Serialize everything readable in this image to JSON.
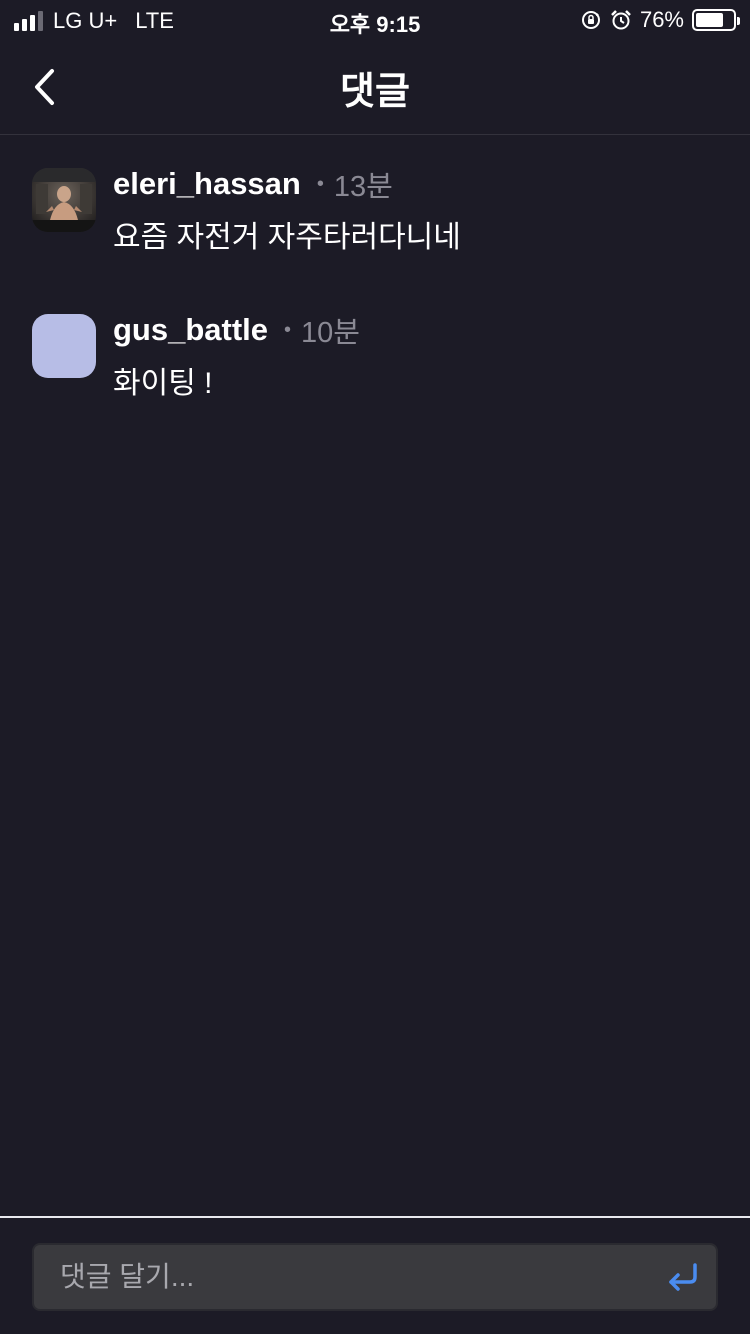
{
  "status_bar": {
    "carrier": "LG U+",
    "network": "LTE",
    "time": "오후 9:15",
    "battery": "76%",
    "battery_level": 0.76
  },
  "nav": {
    "title": "댓글",
    "back_icon": "chevron-left-icon"
  },
  "comments": [
    {
      "username": "eleri_hassan",
      "time": "13분",
      "text": "요즘 자전거 자주타러다니네",
      "avatar": "photo"
    },
    {
      "username": "gus_battle",
      "time": "10분",
      "text": "화이팅 !",
      "avatar": "placeholder",
      "avatar_color": "#b7bde6"
    }
  ],
  "input": {
    "placeholder": "댓글 달기...",
    "send_icon": "return-arrow-icon"
  },
  "colors": {
    "background": "#1c1b26",
    "accent": "#4a8cf0"
  }
}
